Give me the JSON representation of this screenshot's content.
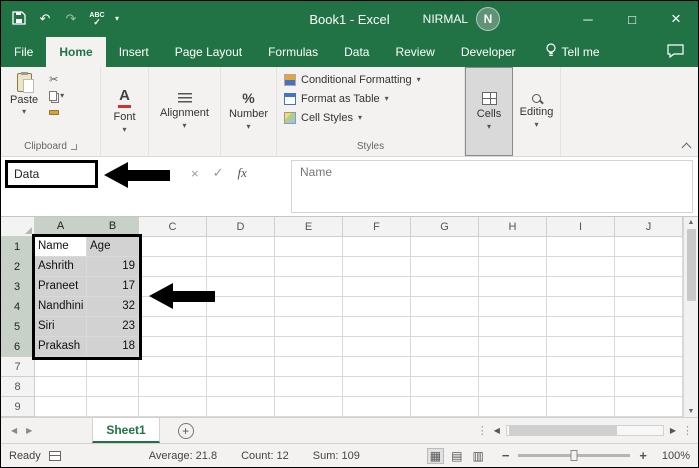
{
  "colors": {
    "excel_green": "#217346",
    "selection_fill": "#d2d2d2",
    "annotation": "#000000"
  },
  "titlebar": {
    "title": "Book1 - Excel",
    "user_name": "NIRMAL",
    "avatar_initial": "N"
  },
  "menubar": {
    "tabs": [
      "File",
      "Home",
      "Insert",
      "Page Layout",
      "Formulas",
      "Data",
      "Review",
      "Developer"
    ],
    "active_tab": "Home",
    "tell_me": "Tell me"
  },
  "ribbon": {
    "paste": "Paste",
    "groups": {
      "clipboard": "Clipboard",
      "font": "Font",
      "alignment": "Alignment",
      "number": "Number",
      "styles": "Styles",
      "cells": "Cells",
      "editing": "Editing"
    },
    "styles_items": [
      "Conditional Formatting",
      "Format as Table",
      "Cell Styles"
    ]
  },
  "formula_row": {
    "name_box": "Data",
    "fx": "fx",
    "formula_text": "Name"
  },
  "grid": {
    "columns": [
      "A",
      "B",
      "C",
      "D",
      "E",
      "F",
      "G",
      "H",
      "I",
      "J"
    ],
    "rows": [
      "1",
      "2",
      "3",
      "4",
      "5",
      "6",
      "7",
      "8",
      "9"
    ],
    "cells": [
      [
        "Name",
        "Age"
      ],
      [
        "Ashrith",
        "19"
      ],
      [
        "Praneet",
        "17"
      ],
      [
        "Nandhini",
        "32"
      ],
      [
        "Siri",
        "23"
      ],
      [
        "Prakash",
        "18"
      ]
    ],
    "selection": {
      "range": "A1:B6",
      "active_cell": "A1",
      "selected_columns": [
        "A",
        "B"
      ],
      "selected_rows": [
        "1",
        "2",
        "3",
        "4",
        "5",
        "6"
      ]
    }
  },
  "sheetbar": {
    "active_sheet": "Sheet1"
  },
  "statusbar": {
    "mode": "Ready",
    "average": "Average: 21.8",
    "count": "Count: 12",
    "sum": "Sum: 109",
    "zoom": "100%"
  }
}
